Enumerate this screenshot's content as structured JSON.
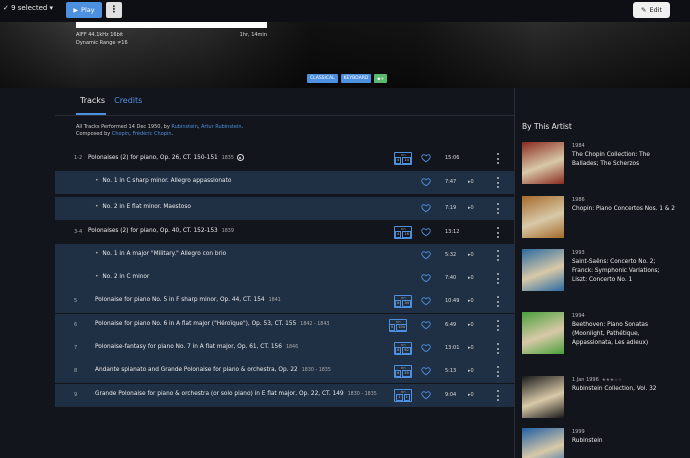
{
  "topbar": {
    "selected_label": "9 selected",
    "play_label": "Play",
    "more_label": "⋮",
    "edit_label": "Edit"
  },
  "header": {
    "format_info": "AIFF 44.1kHz 16bit",
    "duration": "1hr, 14min",
    "dynamic_range": "Dynamic Range  ≠16",
    "tags": [
      "CLASSICAL",
      "KEYBOARD"
    ]
  },
  "tabs": [
    "Tracks",
    "Credits"
  ],
  "credits": {
    "line1_prefix": "All Tracks Performed 14 Dec 1950, by",
    "line1_artist1": "Rubinstein",
    "line1_sep": ",",
    "line1_artist2": "Artur Rubinstein",
    "line1_end": ".",
    "line2_prefix": "Composed by",
    "line2_comp1": "Chopin",
    "line2_sep": ",",
    "line2_comp2": "Frédéric Chopin",
    "line2_end": "."
  },
  "tracks": [
    {
      "num": "1-2",
      "title": "Polonaises (2) for piano, Op. 26, CT. 150-151",
      "year": "1835",
      "hd_top": "",
      "hd_a": "4",
      "hd_b": "14",
      "duration": "15:06",
      "plays": "",
      "kind": "group"
    },
    {
      "num": "",
      "title": "No. 1 in C sharp minor. Allegro appassionato",
      "year": "",
      "duration": "7:47",
      "plays": "▸0",
      "kind": "sub"
    },
    {
      "num": "",
      "title": "No. 2 in E flat minor. Maestoso",
      "year": "",
      "duration": "7:19",
      "plays": "▸0",
      "kind": "sub"
    },
    {
      "num": "3-4",
      "title": "Polonaises (2) for piano, Op. 40, CT. 152-153",
      "year": "1839",
      "hd_top": "",
      "hd_a": "4",
      "hd_b": "16",
      "duration": "13:12",
      "plays": "",
      "kind": "group"
    },
    {
      "num": "",
      "title": "No. 1 in A major \"Military.\" Allegro con brio",
      "year": "",
      "duration": "5:32",
      "plays": "▸0",
      "kind": "sub"
    },
    {
      "num": "",
      "title": "No. 2 in C minor",
      "year": "",
      "duration": "7:40",
      "plays": "▸0",
      "kind": "sub"
    },
    {
      "num": "5",
      "title": "Polonaise for piano No. 5 in F sharp minor, Op. 44, CT. 154",
      "year": "1841",
      "hd_top": "",
      "hd_a": "6",
      "hd_b": "34",
      "duration": "10:49",
      "plays": "▸0",
      "kind": "single"
    },
    {
      "num": "6",
      "title": "Polonaise for piano No. 6 in A flat major (\"Héroïque\"), Op. 53, CT. 155",
      "year": "1842 - 1843",
      "hd_top": "",
      "hd_a": "5",
      "hd_b": "104",
      "duration": "6:49",
      "plays": "▸0",
      "kind": "single"
    },
    {
      "num": "7",
      "title": "Polonaise-fantasy for piano No. 7 in A flat major, Op. 61, CT. 156",
      "year": "1846",
      "hd_top": "",
      "hd_a": "6",
      "hd_b": "62",
      "duration": "13:01",
      "plays": "▸0",
      "kind": "single"
    },
    {
      "num": "8",
      "title": "Andante spianato and Grande Polonaise for piano & orchestra, Op. 22",
      "year": "1830 - 1835",
      "hd_top": "",
      "hd_a": "6",
      "hd_b": "55",
      "duration": "5:13",
      "plays": "▸0",
      "kind": "single"
    },
    {
      "num": "9",
      "title": "Grande Polonaise for piano & orchestra (or solo piano) in E flat major, Op. 22, CT. 149",
      "year": "1830 - 1835",
      "hd_top": "",
      "hd_a": "1",
      "hd_b": "1",
      "duration": "9:04",
      "plays": "▸0",
      "kind": "single"
    }
  ],
  "sidebar": {
    "title": "By This Artist",
    "albums": [
      {
        "year": "1984",
        "title": "The Chopin Collection: The Ballades; The Scherzos",
        "rating": "",
        "cover_color": "#8a2a1e"
      },
      {
        "year": "1986",
        "title": "Chopin: Piano Concertos Nos. 1 & 2",
        "rating": "",
        "cover_color": "#a56a2a"
      },
      {
        "year": "1993",
        "title": "Saint-Saëns: Concerto No. 2; Franck: Symphonic Variations; Liszt: Concerto No. 1",
        "rating": "",
        "cover_color": "#2a6aa0"
      },
      {
        "year": "1994",
        "title": "Beethoven: Piano Sonatas (Moonlight, Pathétique, Appassionata, Les adieux)",
        "rating": "",
        "cover_color": "#4aa03a"
      },
      {
        "year": "1 Jan 1996",
        "title": "Rubinstein Collection, Vol. 32",
        "rating": "★★★☆☆",
        "cover_color": "#1a1a1a"
      },
      {
        "year": "1999",
        "title": "Rubinstein",
        "rating": "",
        "cover_color": "#1f5fa5"
      }
    ]
  },
  "colors": {
    "accent": "#4d90e0",
    "selected_row": "#1f2f44",
    "background": "#13151c"
  }
}
